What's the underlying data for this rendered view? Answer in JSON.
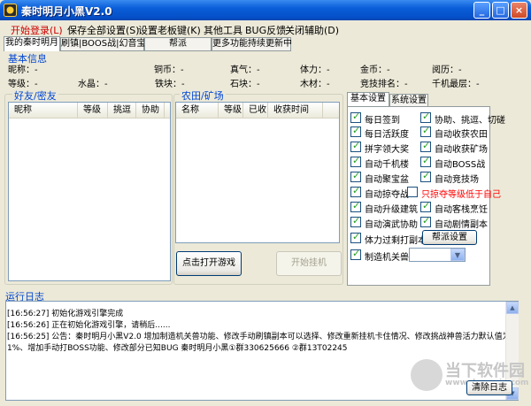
{
  "window": {
    "title": "秦时明月小黑V2.0",
    "controls": {
      "minimize": "_",
      "maximize": "□",
      "close": "×"
    }
  },
  "menu": [
    {
      "label": "开始登录(L)",
      "active": true
    },
    {
      "label": "保存全部设置(S)"
    },
    {
      "label": "设置老板键(K)"
    },
    {
      "label": "其他工具"
    },
    {
      "label": "BUG反馈"
    },
    {
      "label": "关闭辅助(D)"
    }
  ],
  "tabs": [
    {
      "label": "我的秦时明月",
      "selected": true
    },
    {
      "label": "刷镇|BOOS战|幻音宝盒"
    },
    {
      "label": "帮派"
    },
    {
      "label": "更多功能持续更新中"
    }
  ],
  "basic_info": {
    "title": "基本信息",
    "fields": [
      {
        "label": "昵称：",
        "value": "-"
      },
      {
        "label": "铜币：",
        "value": "-"
      },
      {
        "label": "真气：",
        "value": "-"
      },
      {
        "label": "体力：",
        "value": "-"
      },
      {
        "label": "金币：",
        "value": "-"
      },
      {
        "label": "阅历：",
        "value": "-"
      },
      {
        "label": "等级：",
        "value": "-"
      },
      {
        "label": "水晶：",
        "value": "-"
      },
      {
        "label": "铁块：",
        "value": "-"
      },
      {
        "label": "石块：",
        "value": "-"
      },
      {
        "label": "木材：",
        "value": "-"
      },
      {
        "label": "竞技排名：",
        "value": "-"
      },
      {
        "label": "千机最层：",
        "value": "-"
      }
    ]
  },
  "friends": {
    "title": "好友/密友",
    "columns": [
      "昵称",
      "等级",
      "挑逗",
      "协助"
    ]
  },
  "farm": {
    "title": "农田/矿场",
    "columns": [
      "名称",
      "等级",
      "已收",
      "收获时间"
    ]
  },
  "buttons": {
    "open_game": "点击打开游戏",
    "start_hang": "开始挂机",
    "faction_settings": "帮派设置",
    "clear_log": "清除日志"
  },
  "settings": {
    "tabs": [
      {
        "label": "基本设置",
        "selected": true
      },
      {
        "label": "系统设置"
      }
    ],
    "checkboxes": [
      {
        "label": "每日签到",
        "checked": true
      },
      {
        "label": "协助、挑逗、切磋",
        "checked": true
      },
      {
        "label": "每日活跃度",
        "checked": true
      },
      {
        "label": "自动收获农田",
        "checked": true
      },
      {
        "label": "拼字领大奖",
        "checked": true
      },
      {
        "label": "自动收获矿场",
        "checked": true
      },
      {
        "label": "自动千机楼",
        "checked": true
      },
      {
        "label": "自动BOSS战",
        "checked": true
      },
      {
        "label": "自动聚宝盆",
        "checked": true
      },
      {
        "label": "自动竞技场",
        "checked": true
      },
      {
        "label": "自动掠夺战",
        "checked": true
      },
      {
        "label": "只掠夺等级低于自己",
        "checked": false,
        "red": true
      },
      {
        "label": "自动升级建筑",
        "checked": true
      },
      {
        "label": "自动客栈烹饪",
        "checked": true
      },
      {
        "label": "自动演武协助",
        "checked": true
      },
      {
        "label": "自动剧情副本",
        "checked": true
      },
      {
        "label": "体力过剩打副本",
        "checked": true
      },
      {
        "label": "制造机关兽",
        "checked": true
      }
    ],
    "select_value": ""
  },
  "log": {
    "title": "运行日志",
    "lines": [
      "[16:56:27] 初始化游戏引擎完成",
      "[16:56:26] 正在初始化游戏引擎，请稍后......",
      "[16:56:25] 公告：秦时明月小黑V2.0 增加制造机关兽功能、修改手动刷镇副本可以选择、修改重新挂机卡住情况、修改挑战神兽活力默认值为",
      "1%、增加手动打BOSS功能、修改部分已知BUG     秦时明月小黑①群330625666    ②群13T02245"
    ]
  },
  "watermark": {
    "text": "当下软件园",
    "sub": "www.downxia.com"
  },
  "colors": {
    "titlebar": "#0a5ed8",
    "group_title": "#0046d5",
    "check": "#21a121",
    "warning": "#ff0000"
  }
}
